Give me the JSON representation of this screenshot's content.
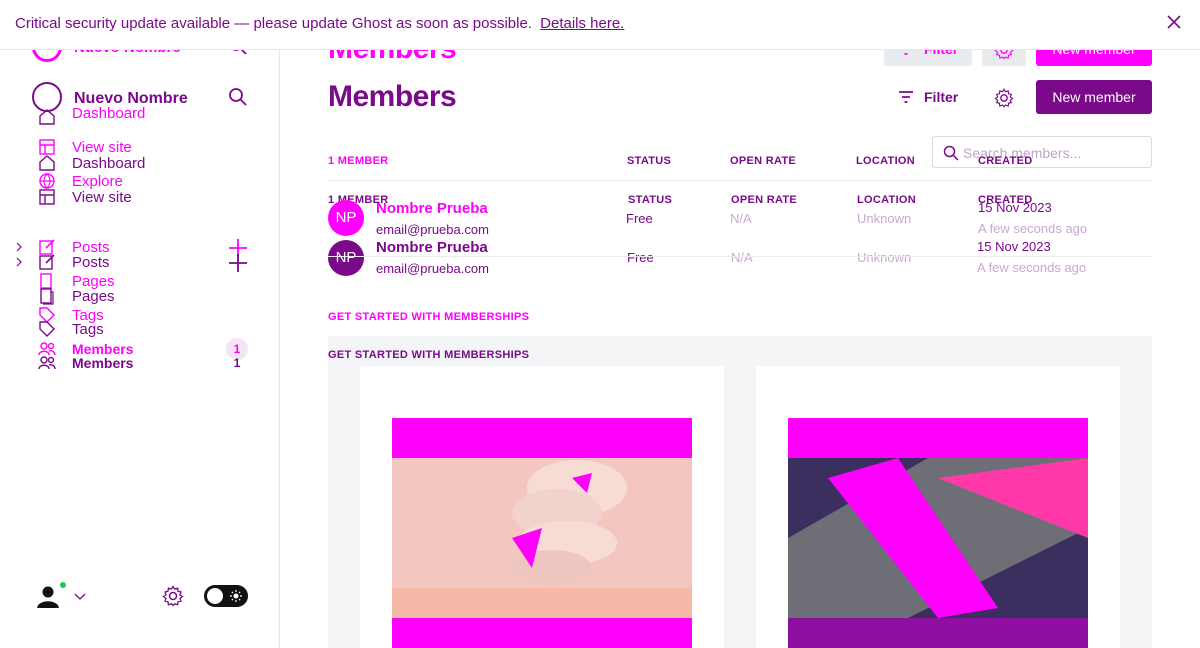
{
  "banner": {
    "message": "Critical security update available — please update Ghost as soon as possible.",
    "link": "Details here."
  },
  "sidebar": {
    "brand_name": "Nuevo Nombre",
    "top_links": [
      {
        "label": "Dashboard"
      },
      {
        "label": "View site"
      },
      {
        "label": "Dashboard"
      },
      {
        "label": "Explore"
      },
      {
        "label": "View site"
      }
    ],
    "content_links": [
      {
        "label": "Posts"
      },
      {
        "label": "Posts"
      },
      {
        "label": "Pages"
      },
      {
        "label": "Pages"
      },
      {
        "label": "Tags"
      },
      {
        "label": "Tags"
      },
      {
        "label": "Members",
        "count": "1"
      },
      {
        "label": "Members",
        "count": "1"
      }
    ]
  },
  "header": {
    "title": "Members",
    "filter_label": "Filter",
    "new_member_label": "New member",
    "search_placeholder": "Search members..."
  },
  "table": {
    "columns": [
      "1 MEMBER",
      "STATUS",
      "OPEN RATE",
      "LOCATION",
      "CREATED"
    ],
    "rows": [
      {
        "initials": "NP",
        "name": "Nombre Prueba",
        "email": "email@prueba.com",
        "status": "Free",
        "open_rate": "N/A",
        "location": "Unknown",
        "created": "15 Nov 2023",
        "created_ago": "A few seconds ago"
      }
    ]
  },
  "get_started": {
    "title": "GET STARTED WITH MEMBERSHIPS"
  },
  "colors": {
    "accent": "#ff00ff",
    "primary": "#7a0a8a",
    "muted": "#c9a8d1",
    "online": "#23c552"
  }
}
